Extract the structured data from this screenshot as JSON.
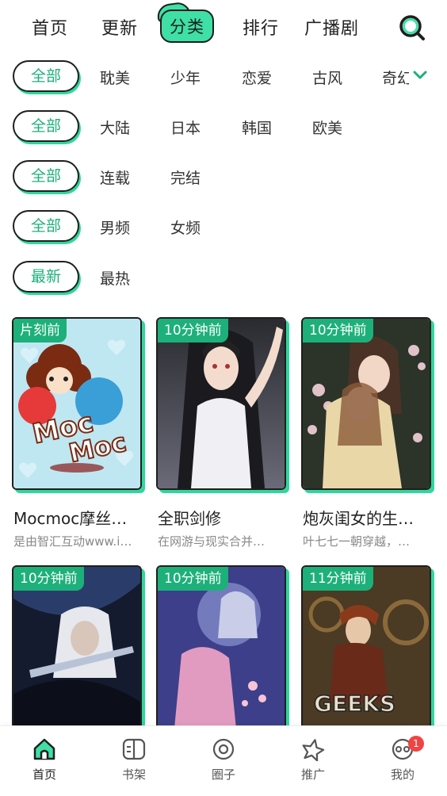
{
  "topnav": {
    "tabs": [
      "首页",
      "更新",
      "分类",
      "排行",
      "广播剧"
    ],
    "active_index": 2
  },
  "filters": [
    {
      "selected": "全部",
      "options": [
        "耽美",
        "少年",
        "恋爱",
        "古风",
        "奇幻"
      ]
    },
    {
      "selected": "全部",
      "options": [
        "大陆",
        "日本",
        "韩国",
        "欧美"
      ]
    },
    {
      "selected": "全部",
      "options": [
        "连载",
        "完结"
      ]
    },
    {
      "selected": "全部",
      "options": [
        "男频",
        "女频"
      ]
    },
    {
      "selected": "最新",
      "options": [
        "最热"
      ]
    }
  ],
  "cards": [
    {
      "badge": "片刻前",
      "title": "Mocmoc摩丝…",
      "desc": "是由智汇互动www.i…",
      "cover_text": "Moc Moc"
    },
    {
      "badge": "10分钟前",
      "title": "全职剑修",
      "desc": "在网游与现实合并…"
    },
    {
      "badge": "10分钟前",
      "title": "炮灰闺女的生…",
      "desc": "叶七七一朝穿越，…"
    },
    {
      "badge": "10分钟前",
      "title": "",
      "desc": ""
    },
    {
      "badge": "10分钟前",
      "title": "",
      "desc": ""
    },
    {
      "badge": "11分钟前",
      "title": "",
      "desc": "",
      "cover_text": "GEEKS"
    }
  ],
  "bottomnav": {
    "items": [
      "首页",
      "书架",
      "圈子",
      "推广",
      "我的"
    ],
    "active_index": 0,
    "badge_count": "1"
  },
  "colors": {
    "accent": "#1db07a",
    "accent_light": "#3ee0a6",
    "badge_red": "#f04444"
  }
}
